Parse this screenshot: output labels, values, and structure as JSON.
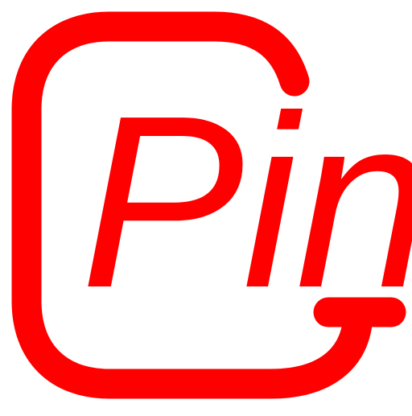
{
  "logo": {
    "text": "Pin",
    "color": "#ff0000",
    "icon": "g-letter-frame-icon"
  }
}
